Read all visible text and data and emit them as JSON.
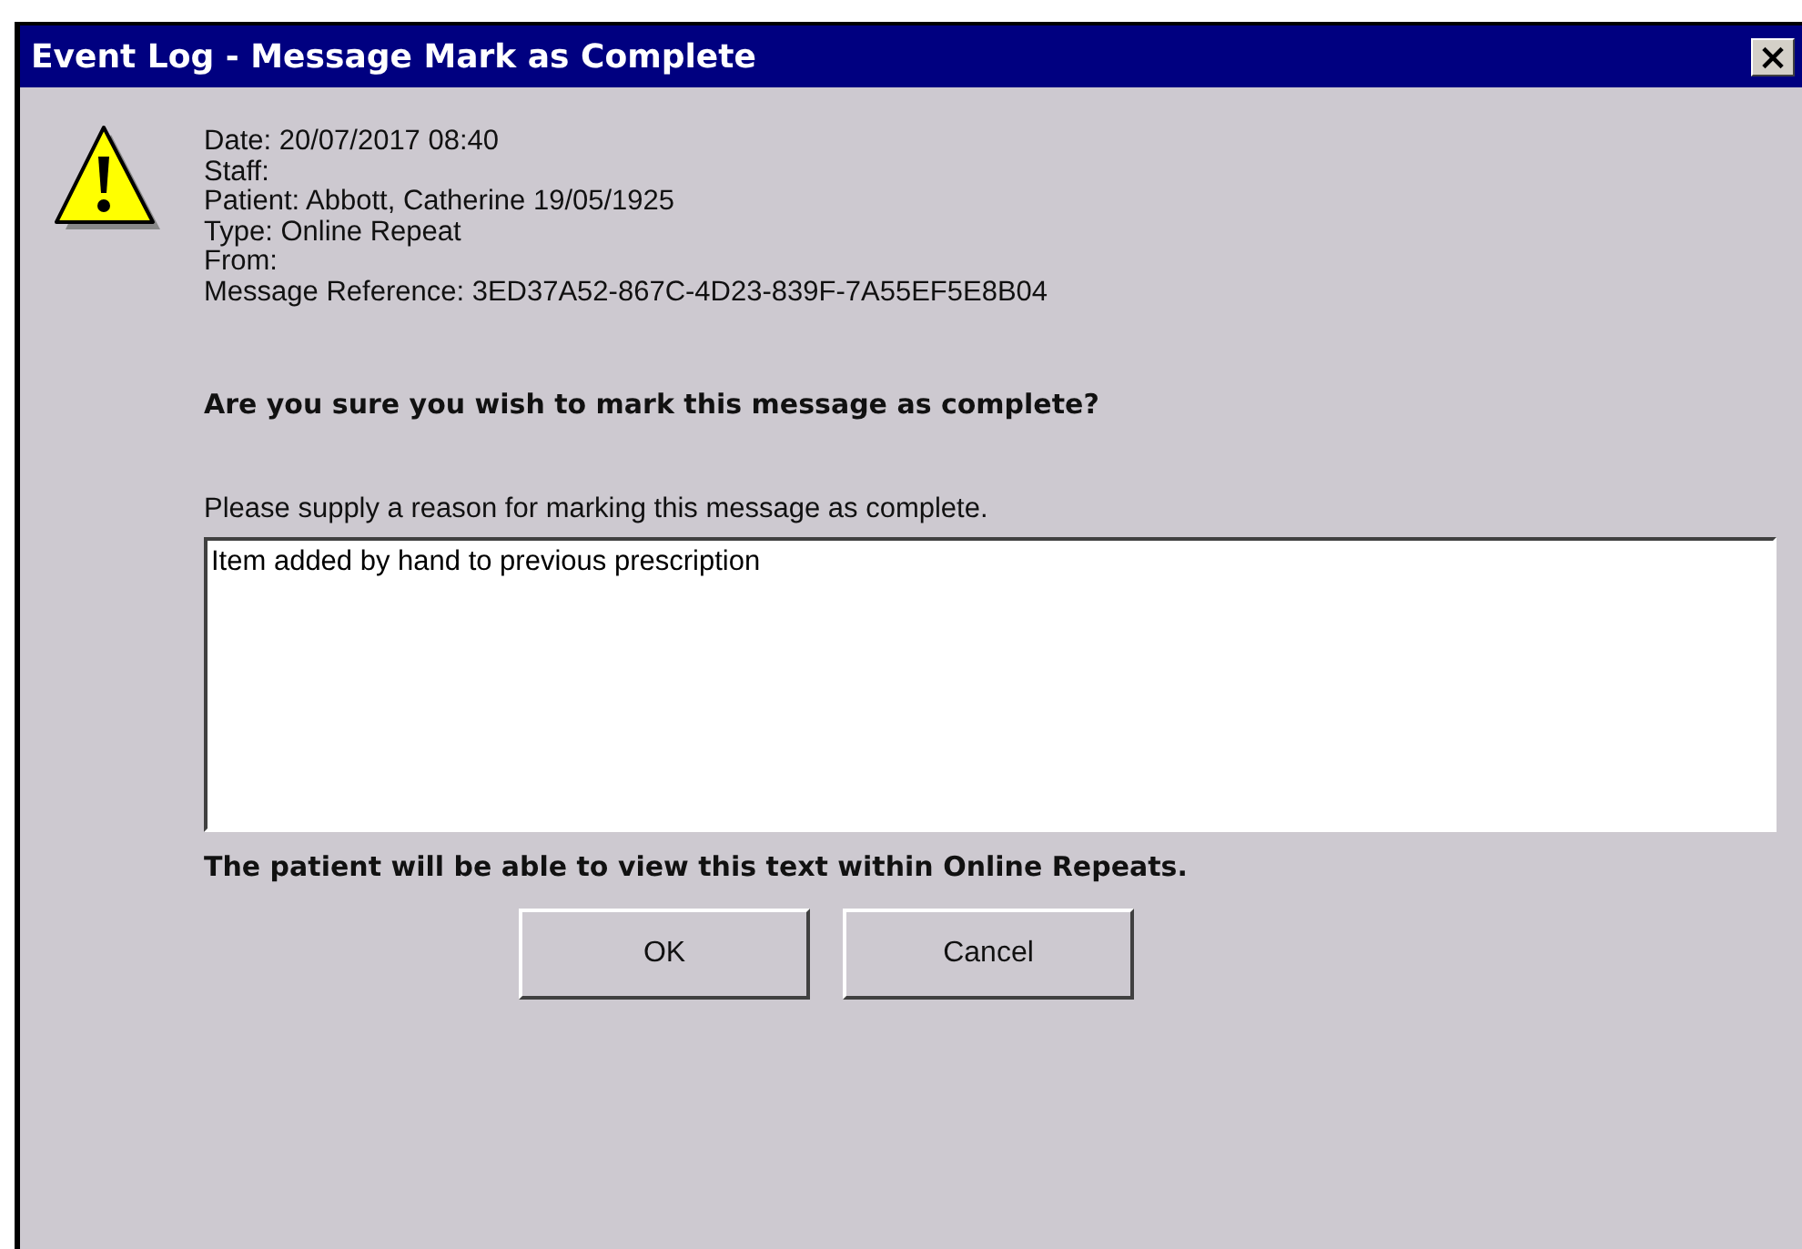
{
  "window": {
    "title": "Event Log - Message Mark as Complete",
    "close": "×"
  },
  "details": [
    "Date: 20/07/2017 08:40",
    "Staff:",
    "Patient: Abbott, Catherine 19/05/1925",
    "Type: Online Repeat",
    "From:",
    "Message Reference: 3ED37A52-867C-4D23-839F-7A55EF5E8B04"
  ],
  "question": "Are you sure you wish to mark this message as complete?",
  "reason": {
    "label": "Please supply a reason for marking this message as complete.",
    "value": "Item added by hand to previous prescription"
  },
  "note": "The patient will be able to view this text within Online Repeats.",
  "buttons": [
    "OK",
    "Cancel"
  ]
}
